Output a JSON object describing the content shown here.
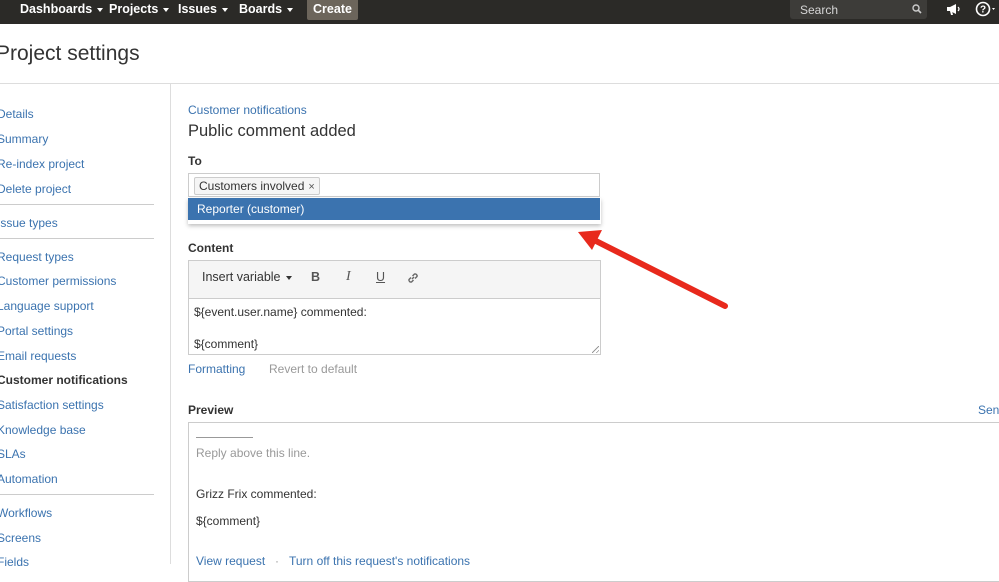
{
  "topnav": {
    "items": [
      "Dashboards",
      "Projects",
      "Issues",
      "Boards"
    ],
    "create_label": "Create",
    "search_placeholder": "Search",
    "icons": [
      "search-icon",
      "megaphone-icon",
      "help-icon"
    ]
  },
  "page": {
    "title": "Project settings"
  },
  "sidebar": {
    "groups": [
      [
        "Details",
        "Summary",
        "Re-index project",
        "Delete project"
      ],
      [
        "Issue types"
      ],
      [
        "Request types",
        "Customer permissions",
        "Language support",
        "Portal settings",
        "Email requests",
        "Customer notifications",
        "Satisfaction settings",
        "Knowledge base",
        "SLAs",
        "Automation"
      ],
      [
        "Workflows",
        "Screens",
        "Fields"
      ]
    ],
    "active": "Customer notifications"
  },
  "main": {
    "breadcrumb": "Customer notifications",
    "heading": "Public comment added",
    "to_label": "To",
    "to_chip": "Customers involved",
    "dropdown_option": "Reporter (customer)",
    "content_label": "Content",
    "insert_variable": "Insert variable",
    "toolbar": {
      "bold": "B",
      "italic": "I",
      "underline": "U"
    },
    "content_lines": [
      "${event.user.name} commented:",
      "",
      "${comment}"
    ],
    "formatting_link": "Formatting",
    "revert_link": "Revert to default",
    "preview_label": "Preview",
    "send_link": "Sen",
    "preview": {
      "reply_above": "Reply above this line.",
      "commenter": "Grizz Frix commented:",
      "comment": "${comment}",
      "view_request": "View request",
      "separator": "·",
      "turn_off": "Turn off this request's notifications"
    }
  },
  "colors": {
    "topbar": "#2b2a27",
    "link": "#3b73af",
    "selected": "#3b73af",
    "arrow": "#e8291c"
  }
}
